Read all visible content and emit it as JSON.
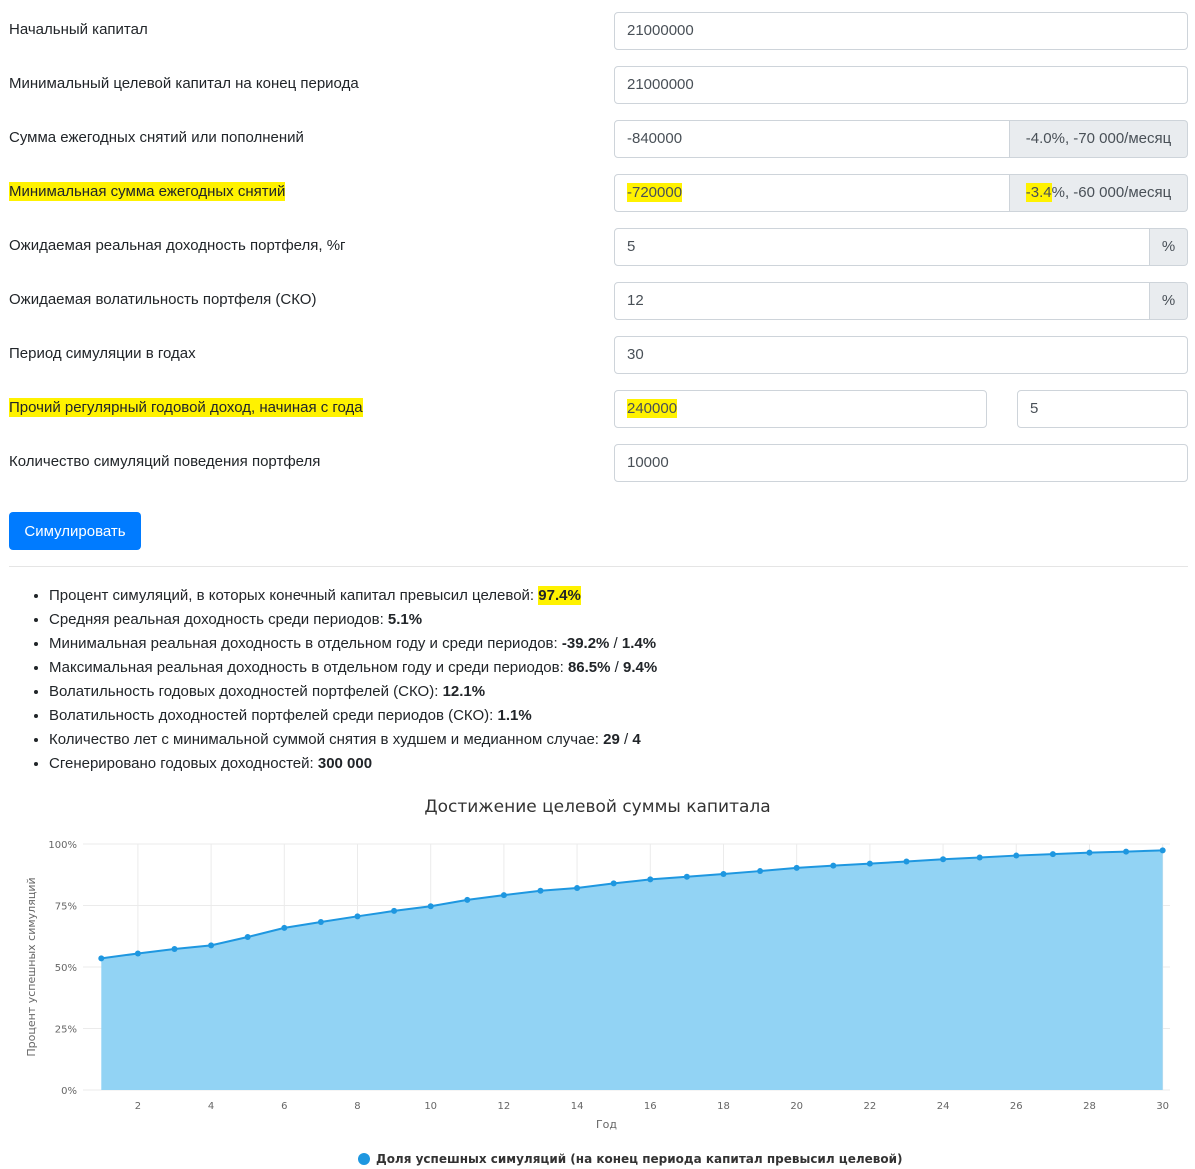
{
  "form": {
    "rows": [
      {
        "label": "Начальный капитал",
        "value": "21000000"
      },
      {
        "label": "Минимальный целевой капитал на конец периода",
        "value": "21000000"
      },
      {
        "label": "Сумма ежегодных снятий или пополнений",
        "value": "-840000",
        "addon": "-4.0%, -70 000/месяц"
      },
      {
        "label": "Минимальная сумма ежегодных снятий",
        "value": "-720000",
        "addon_hl": "-3.4",
        "addon_rest": "%, -60 000/месяц"
      },
      {
        "label": "Ожидаемая реальная доходность портфеля, %г",
        "value": "5",
        "addon": "%"
      },
      {
        "label": "Ожидаемая волатильность портфеля (СКО)",
        "value": "12",
        "addon": "%"
      },
      {
        "label": "Период симуляции в годах",
        "value": "30"
      },
      {
        "label": "Прочий регулярный годовой доход, начиная с года",
        "value": "240000",
        "value2": "5"
      },
      {
        "label": "Количество симуляций поведения портфеля",
        "value": "10000"
      }
    ],
    "simulate_button": "Симулировать"
  },
  "results": [
    {
      "text": "Процент симуляций, в которых конечный капитал превысил целевой: ",
      "v1": "97.4%"
    },
    {
      "text": "Средняя реальная доходность среди периодов: ",
      "v1": "5.1%"
    },
    {
      "text": "Минимальная реальная доходность в отдельном году и среди периодов: ",
      "v1": "-39.2%",
      "sep": " / ",
      "v2": "1.4%"
    },
    {
      "text": "Максимальная реальная доходность в отдельном году и среди периодов: ",
      "v1": "86.5%",
      "sep": " / ",
      "v2": "9.4%"
    },
    {
      "text": "Волатильность годовых доходностей портфелей (СКО): ",
      "v1": "12.1%"
    },
    {
      "text": "Волатильность доходностей портфелей среди периодов (СКО): ",
      "v1": "1.1%"
    },
    {
      "text": "Количество лет с минимальной суммой снятия в худшем и медианном случае: ",
      "v1": "29",
      "sep": " / ",
      "v2": "4"
    },
    {
      "text": "Сгенерировано годовых доходностей: ",
      "v1": "300 000"
    }
  ],
  "chart_data": {
    "type": "area",
    "title": "Достижение целевой суммы капитала",
    "xlabel": "Год",
    "ylabel": "Процент успешных симуляций",
    "x": [
      1,
      2,
      3,
      4,
      5,
      6,
      7,
      8,
      9,
      10,
      11,
      12,
      13,
      14,
      15,
      16,
      17,
      18,
      19,
      20,
      21,
      22,
      23,
      24,
      25,
      26,
      27,
      28,
      29,
      30
    ],
    "series": [
      {
        "name": "Доля успешных симуляций (на конец периода капитал превысил целевой)",
        "values": [
          53.5,
          55.5,
          57.3,
          58.8,
          62.2,
          65.9,
          68.3,
          70.6,
          72.8,
          74.7,
          77.3,
          79.2,
          81.0,
          82.1,
          84.0,
          85.6,
          86.7,
          87.8,
          89.0,
          90.3,
          91.2,
          92.0,
          92.9,
          93.8,
          94.5,
          95.3,
          95.9,
          96.5,
          96.9,
          97.4
        ],
        "color": "#1e97e0",
        "fill": "#92d3f4"
      }
    ],
    "ylim": [
      0,
      100
    ],
    "y_ticks": [
      "0%",
      "25%",
      "50%",
      "75%",
      "100%"
    ],
    "x_ticks": [
      "2",
      "4",
      "6",
      "8",
      "10",
      "12",
      "14",
      "16",
      "18",
      "20",
      "22",
      "24",
      "26",
      "28",
      "30"
    ],
    "grid": true,
    "legend_position": "bottom"
  }
}
